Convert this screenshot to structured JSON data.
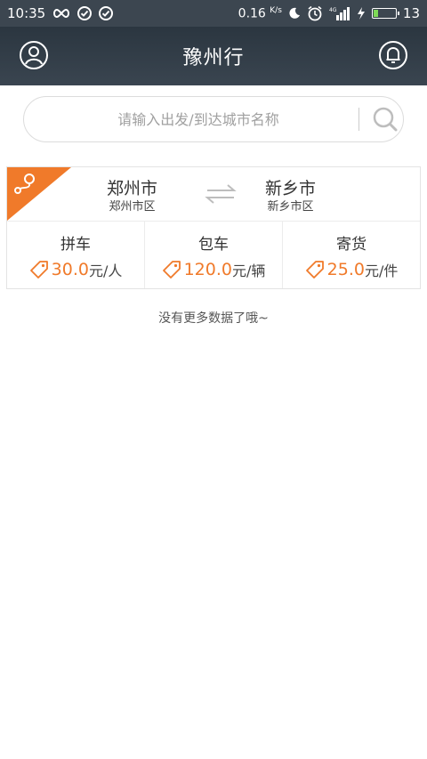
{
  "status_bar": {
    "time": "10:35",
    "speed_value": "0.16",
    "speed_unit": "K/s",
    "network_label": "4G",
    "battery_percent": "13"
  },
  "header": {
    "title": "豫州行"
  },
  "search": {
    "placeholder": "请输入出发/到达城市名称"
  },
  "route": {
    "from_city": "郑州市",
    "from_area": "郑州市区",
    "to_city": "新乡市",
    "to_area": "新乡市区",
    "services": [
      {
        "name": "拼车",
        "price": "30.0",
        "unit": "元/人"
      },
      {
        "name": "包车",
        "price": "120.0",
        "unit": "元/辆"
      },
      {
        "name": "寄货",
        "price": "25.0",
        "unit": "元/件"
      }
    ]
  },
  "footer": {
    "no_more_text": "没有更多数据了哦~"
  },
  "colors": {
    "accent": "#f07a2a",
    "header_bg": "#333d47"
  }
}
